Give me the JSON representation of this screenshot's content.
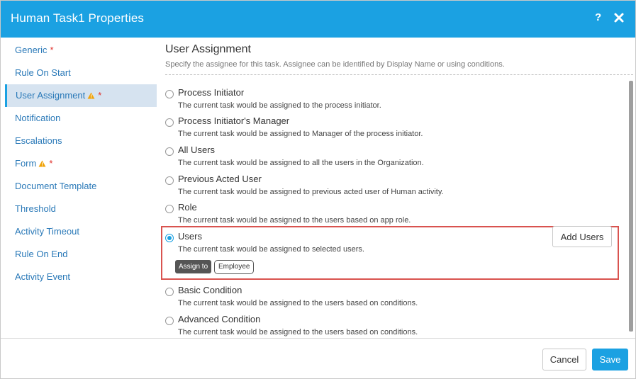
{
  "header": {
    "title": "Human Task1 Properties",
    "help_label": "?"
  },
  "sidebar": {
    "items": [
      {
        "label": "Generic",
        "required": "*"
      },
      {
        "label": "Rule On Start"
      },
      {
        "label": "User Assignment",
        "required": "*",
        "warning": true
      },
      {
        "label": "Notification"
      },
      {
        "label": "Escalations"
      },
      {
        "label": "Form",
        "required": "*",
        "warning": true
      },
      {
        "label": "Document Template"
      },
      {
        "label": "Threshold"
      },
      {
        "label": "Activity Timeout"
      },
      {
        "label": "Rule On End"
      },
      {
        "label": "Activity Event"
      }
    ],
    "active_index": 2
  },
  "main": {
    "title": "User Assignment",
    "description": "Specify the assignee for this task. Assignee can be identified by Display Name or using conditions.",
    "options": [
      {
        "label": "Process Initiator",
        "desc": "The current task would be assigned to the process initiator.",
        "checked": false
      },
      {
        "label": "Process Initiator's Manager",
        "desc": "The current task would be assigned to Manager of the process initiator.",
        "checked": false
      },
      {
        "label": "All Users",
        "desc": "The current task would be assigned to all the users in the Organization.",
        "checked": false
      },
      {
        "label": "Previous Acted User",
        "desc": "The current task would be assigned to previous acted user of Human activity.",
        "checked": false
      },
      {
        "label": "Role",
        "desc": "The current task would be assigned to the users based on app role.",
        "checked": false
      },
      {
        "label": "Users",
        "desc": "The current task would be assigned to selected users.",
        "checked": true
      },
      {
        "label": "Basic Condition",
        "desc": "The current task would be assigned to the users based on conditions.",
        "checked": false
      },
      {
        "label": "Advanced Condition",
        "desc": "The current task would be assigned to the users based on conditions.",
        "checked": false
      }
    ],
    "add_users_label": "Add Users",
    "assign_to_label": "Assign to",
    "assignee": "Employee"
  },
  "footer": {
    "cancel_label": "Cancel",
    "save_label": "Save"
  },
  "colors": {
    "accent": "#1ba1e2",
    "highlight_border": "#d9534f",
    "required": "#e0302b",
    "warning": "#f0a30a",
    "link": "#2a79b8"
  },
  "icons": {
    "close": "close-icon",
    "help": "help-icon",
    "warning": "warning-icon"
  }
}
